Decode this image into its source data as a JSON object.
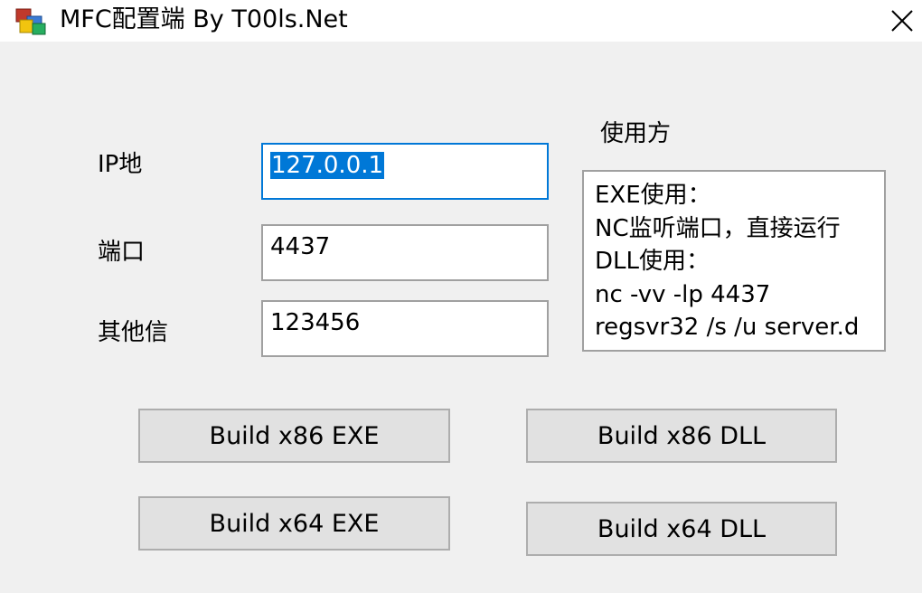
{
  "window": {
    "title": "MFC配置端 By T00ls.Net",
    "app_icon": "mfc-app-icon",
    "close_icon": "close-icon"
  },
  "form": {
    "ip_label": "IP地",
    "ip_value": "127.0.0.1",
    "port_label": "端口",
    "port_value": "4437",
    "other_label": "其他信",
    "other_value": "123456"
  },
  "usage": {
    "title": "使用方",
    "lines": [
      "EXE使用：",
      "NC监听端口，直接运行",
      "DLL使用：",
      "nc -vv -lp 4437",
      "regsvr32 /s /u server.d"
    ]
  },
  "buttons": {
    "build_x86_exe": "Build x86 EXE",
    "build_x86_dll": "Build x86 DLL",
    "build_x64_exe": "Build x64 EXE",
    "build_x64_dll": "Build x64 DLL"
  },
  "colors": {
    "selection": "#0078d7",
    "focus_border": "#0078d7",
    "dialog_bg": "#f0f0f0",
    "button_bg": "#e1e1e1"
  }
}
